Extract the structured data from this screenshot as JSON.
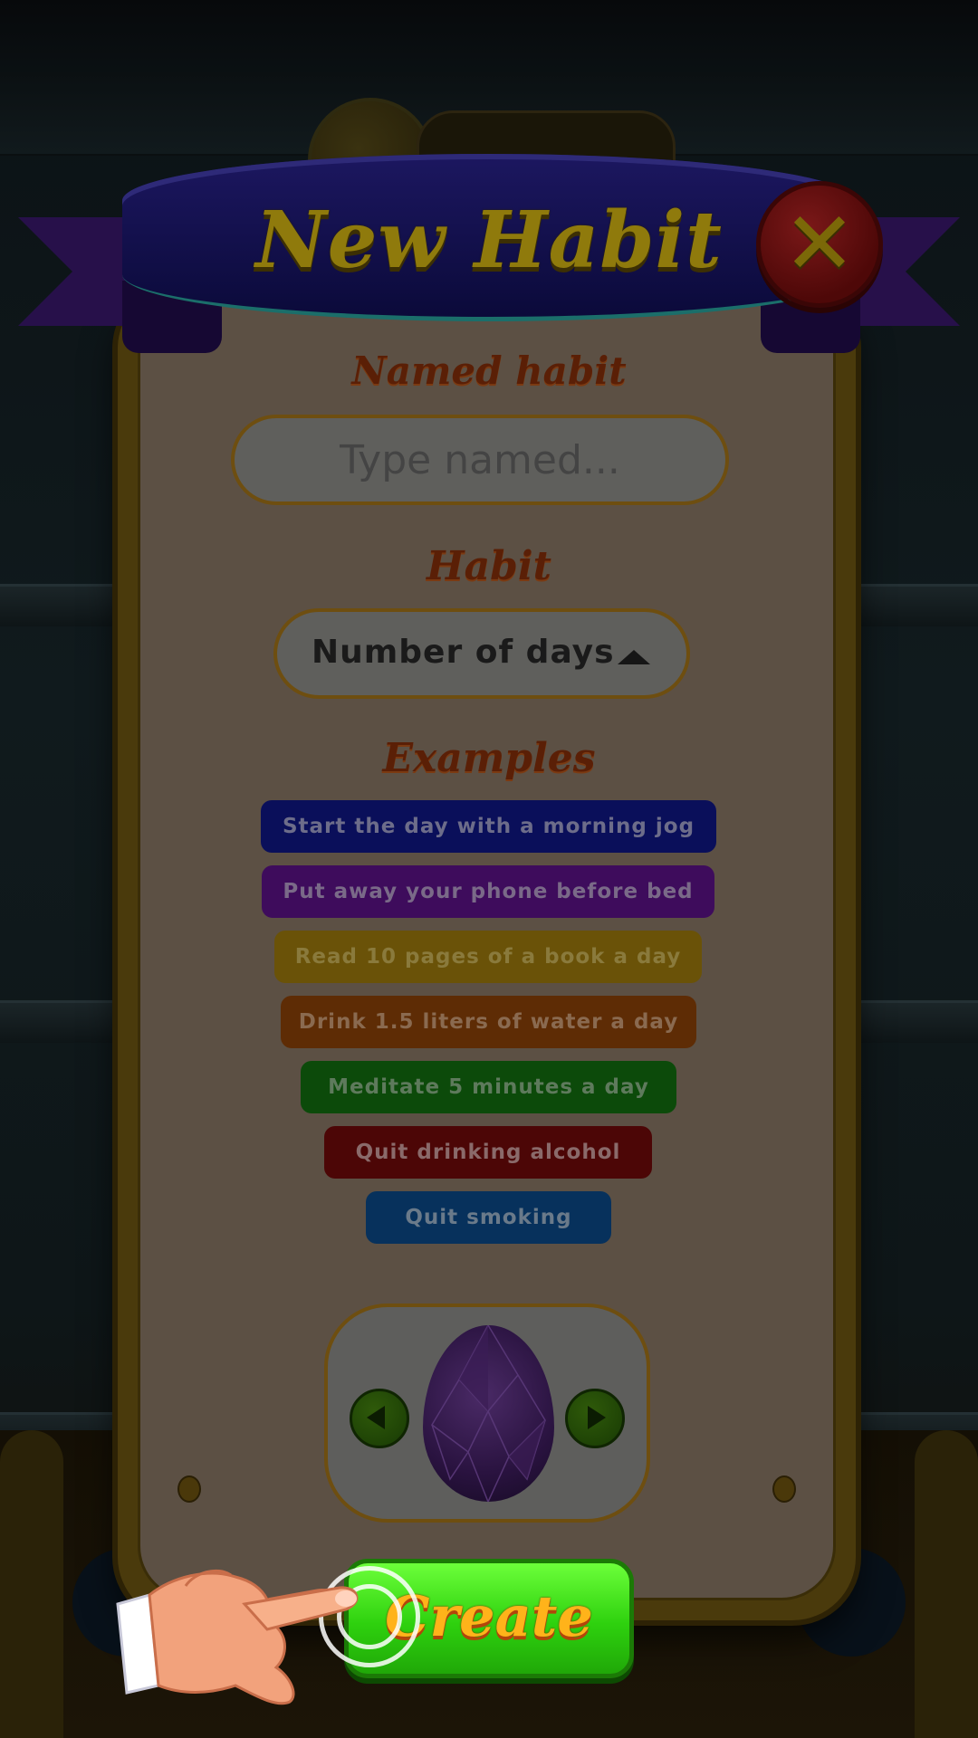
{
  "header": {
    "title": "New Habit"
  },
  "form": {
    "name_label": "Named habit",
    "name_placeholder": "Type named...",
    "habit_label": "Habit",
    "habit_selected": "Number of days",
    "examples_label": "Examples"
  },
  "examples": [
    {
      "label": "Start the day with a morning jog",
      "color": "#0a0f5a"
    },
    {
      "label": "Put away your phone before bed",
      "color": "#3e0c5c"
    },
    {
      "label": "Read 10 pages of a book a day",
      "color": "#6a5208"
    },
    {
      "label": "Drink 1.5 liters of water a day",
      "color": "#5e2c05"
    },
    {
      "label": "Meditate 5 minutes a day",
      "color": "#0c4a0a"
    },
    {
      "label": "Quit drinking alcohol",
      "color": "#4c0606"
    },
    {
      "label": "Quit smoking",
      "color": "#07315c"
    }
  ],
  "actions": {
    "create_label": "Create"
  },
  "icons": {
    "close": "close-icon",
    "prev": "chevron-left-icon",
    "next": "chevron-right-icon",
    "egg": "crystal-egg-icon",
    "hand": "pointing-hand-icon"
  }
}
